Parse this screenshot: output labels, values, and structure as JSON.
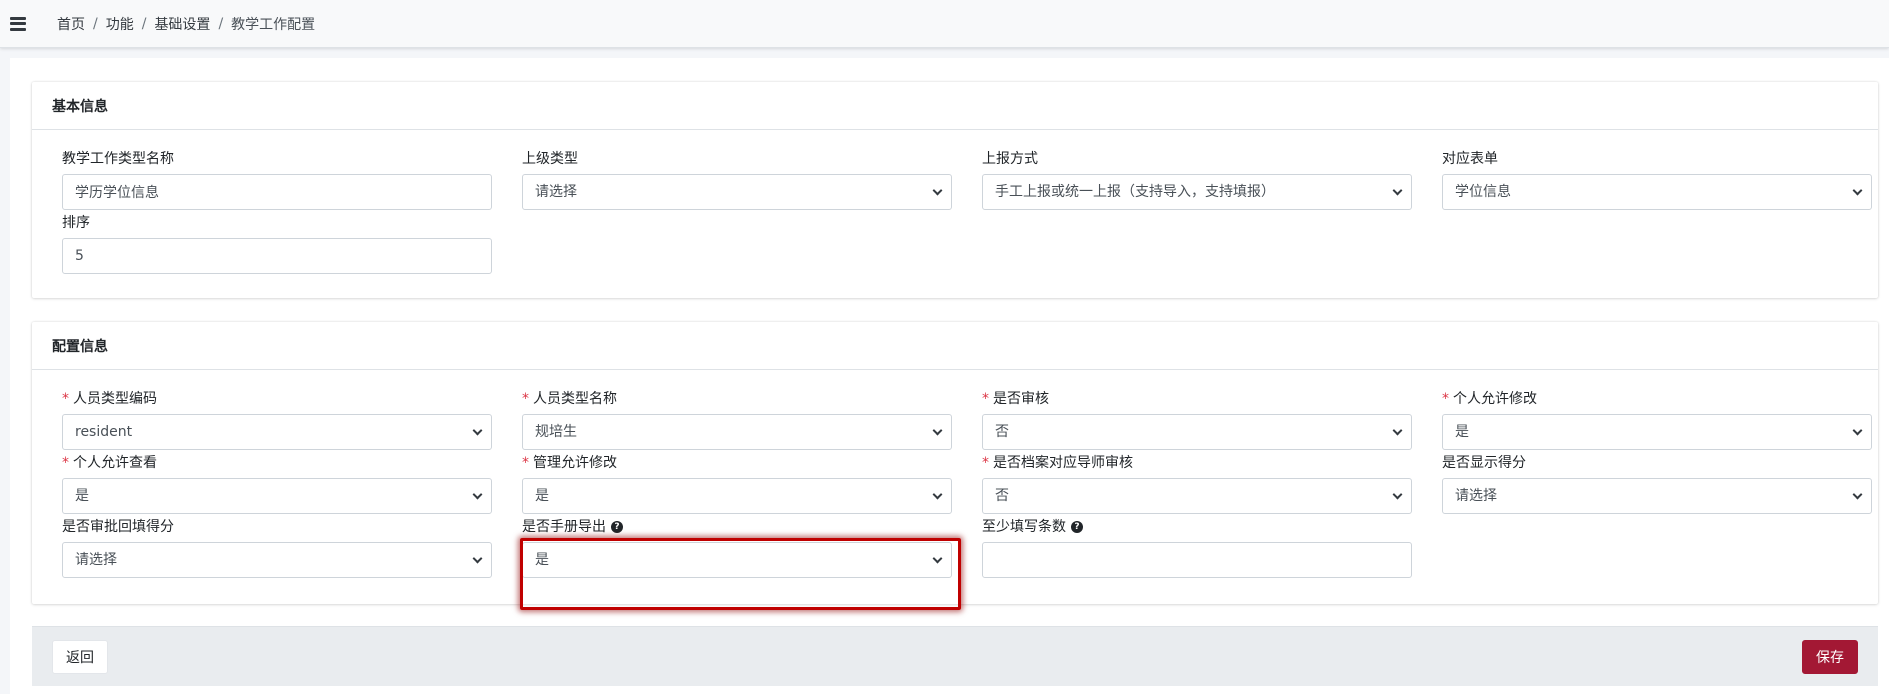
{
  "breadcrumb": {
    "items": [
      "首页",
      "功能",
      "基础设置",
      "教学工作配置"
    ],
    "separator": "/"
  },
  "basic_info": {
    "title": "基本信息",
    "fields": [
      {
        "label": "教学工作类型名称",
        "type": "input",
        "value": "学历学位信息",
        "required": false
      },
      {
        "label": "上级类型",
        "type": "select",
        "value": "请选择",
        "required": false
      },
      {
        "label": "上报方式",
        "type": "select",
        "value": "手工上报或统一上报（支持导入，支持填报）",
        "required": false
      },
      {
        "label": "对应表单",
        "type": "select",
        "value": "学位信息",
        "required": false
      },
      {
        "label": "排序",
        "type": "input",
        "value": "5",
        "required": false
      }
    ]
  },
  "config_info": {
    "title": "配置信息",
    "fields": [
      {
        "label": "人员类型编码",
        "type": "select",
        "value": "resident",
        "required": true
      },
      {
        "label": "人员类型名称",
        "type": "select",
        "value": "规培生",
        "required": true
      },
      {
        "label": "是否审核",
        "type": "select",
        "value": "否",
        "required": true
      },
      {
        "label": "个人允许修改",
        "type": "select",
        "value": "是",
        "required": true
      },
      {
        "label": "个人允许查看",
        "type": "select",
        "value": "是",
        "required": true
      },
      {
        "label": "管理允许修改",
        "type": "select",
        "value": "是",
        "required": true
      },
      {
        "label": "是否档案对应导师审核",
        "type": "select",
        "value": "否",
        "required": true
      },
      {
        "label": "是否显示得分",
        "type": "select",
        "value": "请选择",
        "required": false
      },
      {
        "label": "是否审批回填得分",
        "type": "select",
        "value": "请选择",
        "required": false
      },
      {
        "label": "是否手册导出",
        "type": "select",
        "value": "是",
        "required": false,
        "help_icon": "question-circle-icon"
      },
      {
        "label": "至少填写条数",
        "type": "input",
        "value": "",
        "required": false,
        "help_icon": "question-circle-icon"
      }
    ]
  },
  "required_mark": "*",
  "help_glyph": "?",
  "actions": {
    "back_label": "返回",
    "save_label": "保存"
  },
  "colors": {
    "required": "#dc3545",
    "save_button": "#a31834",
    "highlight": "#c00000"
  }
}
